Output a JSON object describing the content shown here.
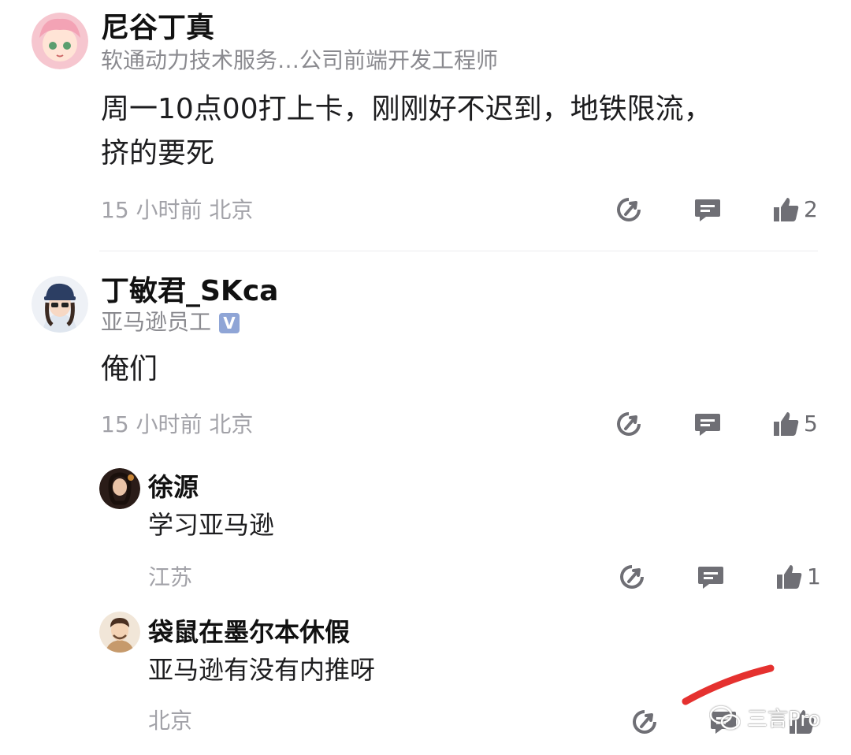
{
  "comments": [
    {
      "user_name": "尼谷丁真",
      "subtitle": "软通动力技术服务…公司前端开发工程师",
      "content_line1": "周一10点00打上卡，刚刚好不迟到，地铁限流，",
      "content_line2": "挤的要死",
      "meta": "15 小时前  北京",
      "likes": "2"
    },
    {
      "user_name": "丁敏君_SKca",
      "subtitle": "亚马逊员工",
      "verified_mark": "V",
      "content": "俺们",
      "meta": "15 小时前  北京",
      "likes": "5",
      "replies": [
        {
          "user_name": "徐源",
          "content": "学习亚马逊",
          "meta": "江苏",
          "likes": "1"
        },
        {
          "user_name": "袋鼠在墨尔本休假",
          "content": "亚马逊有没有内推呀",
          "meta": "北京",
          "likes": ""
        }
      ]
    }
  ],
  "watermark": {
    "text": "三言Pro"
  },
  "icons": {
    "forward": "share-arrow-icon",
    "comment": "comment-icon",
    "like": "thumbs-up-icon"
  },
  "colors": {
    "icon": "#6f6f75",
    "meta": "#a2a2a8",
    "annotation_stroke": "#e5312f"
  }
}
